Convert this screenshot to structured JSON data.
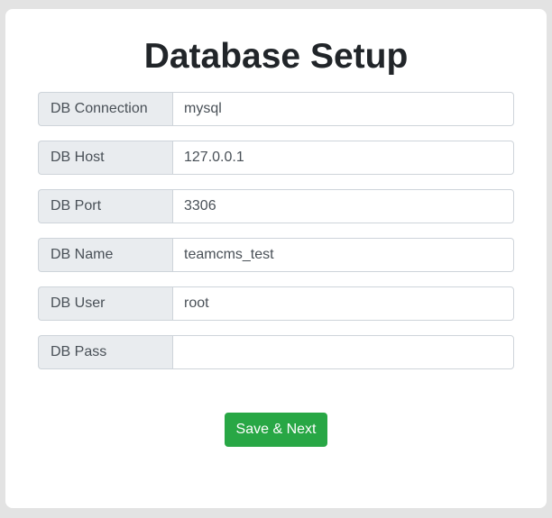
{
  "page": {
    "title": "Database Setup"
  },
  "form": {
    "fields": [
      {
        "label": "DB Connection",
        "value": "mysql"
      },
      {
        "label": "DB Host",
        "value": "127.0.0.1"
      },
      {
        "label": "DB Port",
        "value": "3306"
      },
      {
        "label": "DB Name",
        "value": "teamcms_test"
      },
      {
        "label": "DB User",
        "value": "root"
      },
      {
        "label": "DB Pass",
        "value": ""
      }
    ],
    "submit_label": "Save & Next"
  },
  "colors": {
    "background": "#e3e3e3",
    "card": "#ffffff",
    "label_bg": "#e9ecef",
    "border": "#ced4da",
    "submit": "#28a745"
  }
}
